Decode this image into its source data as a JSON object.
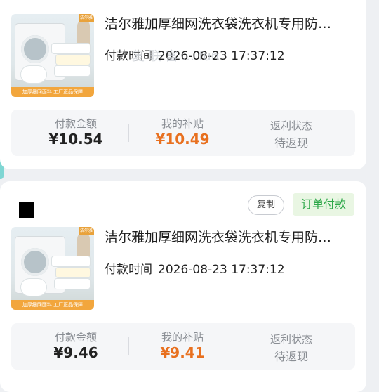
{
  "orders": [
    {
      "product_title": "洁尔雅加厚细网洗衣袋洗衣机专用防…",
      "pay_time_label": "付款时间",
      "pay_time_value": "2026-08-23 17:37:12",
      "thumb_corner": "洁尔雅",
      "thumb_strip": "加厚细网面料   工厂正品保障",
      "stats": {
        "pay_amount_label": "付款金额",
        "pay_amount_value": "¥10.54",
        "subsidy_label": "我的补贴",
        "subsidy_value": "¥10.49",
        "rebate_label": "返利状态",
        "rebate_value": "待返现"
      }
    },
    {
      "copy_label": "复制",
      "status_tag": "订单付款",
      "product_title": "洁尔雅加厚细网洗衣袋洗衣机专用防…",
      "pay_time_label": "付款时间",
      "pay_time_value": "2026-08-23 17:37:12",
      "thumb_corner": "洁尔雅",
      "thumb_strip": "加厚细网面料   工厂正品保障",
      "stats": {
        "pay_amount_label": "付款金额",
        "pay_amount_value": "¥9.46",
        "subsidy_label": "我的补贴",
        "subsidy_value": "¥9.41",
        "rebate_label": "返利状态",
        "rebate_value": "待返现"
      }
    }
  ],
  "watermark": "复 联 富  …  fun",
  "colors": {
    "accent_orange": "#e8701f",
    "status_green": "#2ea84a",
    "status_green_bg": "#e9f6e3"
  }
}
